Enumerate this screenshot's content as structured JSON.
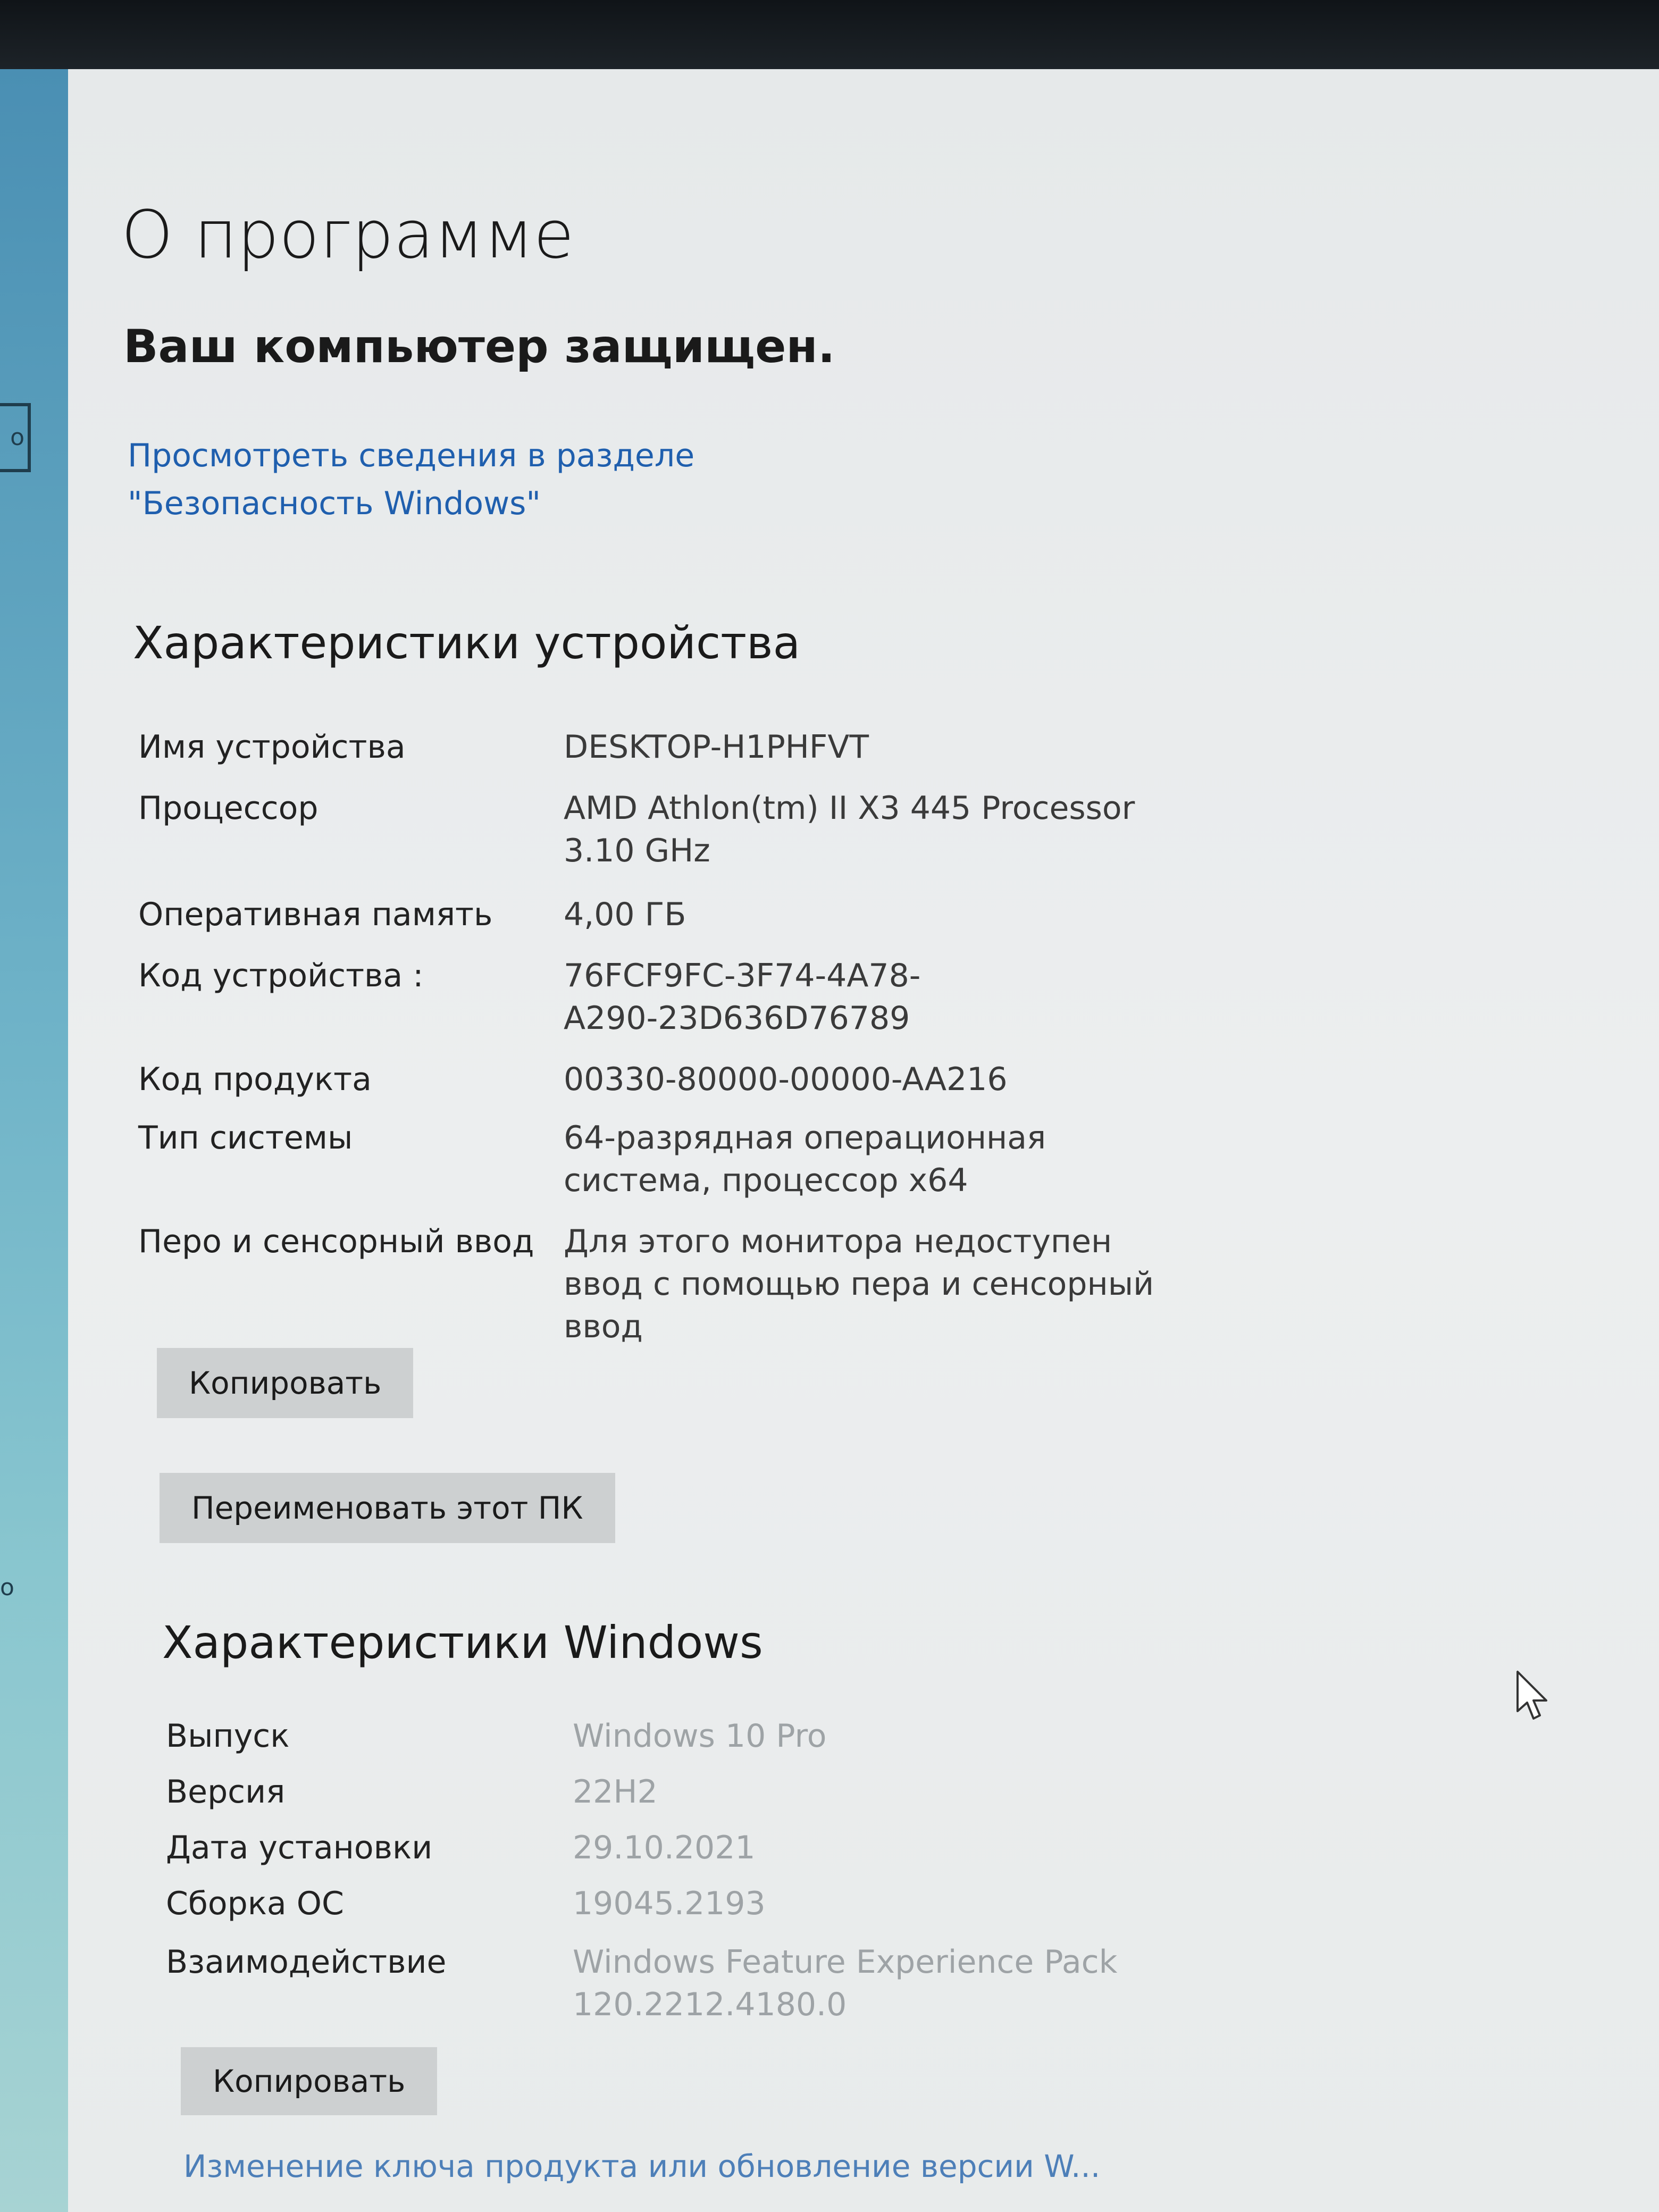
{
  "sidebar": {
    "box_glyph": "о",
    "mark_glyph": "о"
  },
  "page": {
    "title": "О программе",
    "status": "Ваш компьютер защищен.",
    "security_link": "Просмотреть сведения в разделе \"Безопасность Windows\""
  },
  "device_specs": {
    "title": "Характеристики устройства",
    "rows": [
      {
        "label": "Имя устройства",
        "value": "DESKTOP-H1PHFVT"
      },
      {
        "label": "Процессор",
        "value": "AMD Athlon(tm) II X3 445 Processor   3.10 GHz"
      },
      {
        "label": "Оперативная память",
        "value": "4,00 ГБ"
      },
      {
        "label": "Код устройства  :",
        "value": "76FCF9FC-3F74-4A78-A290-23D636D76789"
      },
      {
        "label": "Код продукта",
        "value": "00330-80000-00000-AA216"
      },
      {
        "label": "Тип системы",
        "value": "64-разрядная операционная система, процессор x64"
      },
      {
        "label": "Перо и сенсорный ввод",
        "value": "Для этого монитора недоступен ввод с помощью пера и сенсорный ввод"
      }
    ],
    "copy_button": "Копировать",
    "rename_button": "Переименовать этот ПК"
  },
  "windows_specs": {
    "title": "Характеристики Windows",
    "rows": [
      {
        "label": "Выпуск",
        "value": "Windows 10 Pro"
      },
      {
        "label": "Версия",
        "value": "22H2"
      },
      {
        "label": "Дата установки",
        "value": "29.10.2021"
      },
      {
        "label": "Сборка ОС",
        "value": "19045.2193"
      },
      {
        "label": "Взаимодействие",
        "value": "Windows Feature Experience Pack 120.2212.4180.0"
      }
    ],
    "copy_button": "Копировать"
  },
  "bottom_link": "Изменение ключа продукта или обновление версии W...",
  "colors": {
    "link": "#1f5fae",
    "sidebar": "#6fb3c8",
    "button": "#cdd0d1"
  }
}
